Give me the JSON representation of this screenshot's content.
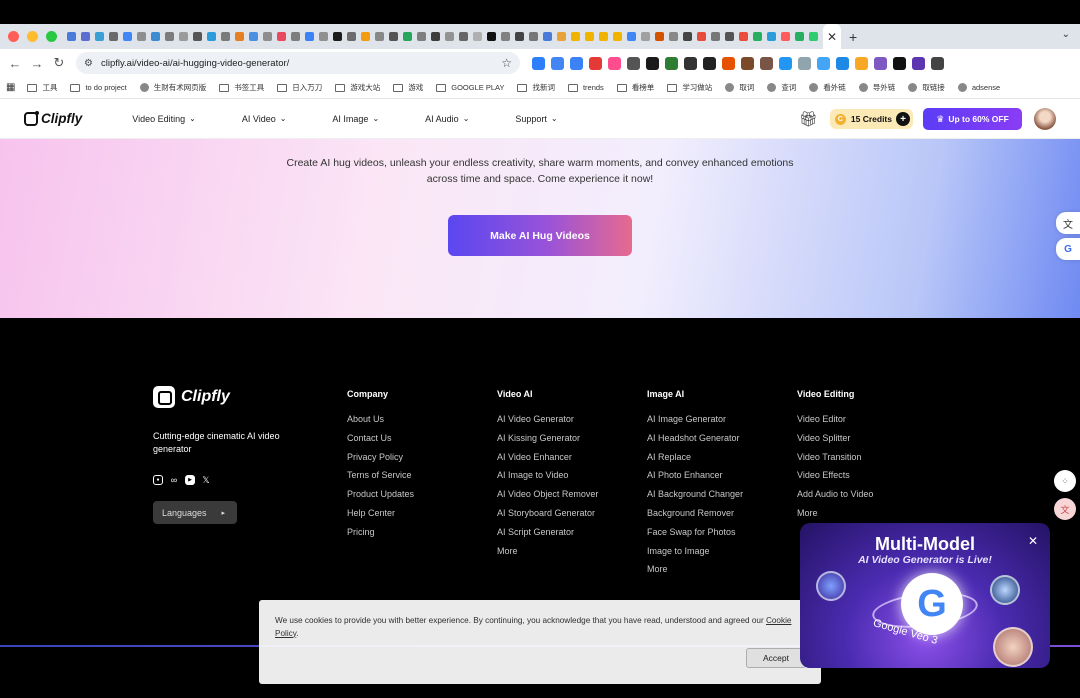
{
  "browser": {
    "url": "clipfly.ai/video-ai/ai-hugging-video-generator/",
    "bookmarks": [
      "工具",
      "to do project",
      "生财有术网页版",
      "书签工具",
      "日入万刀",
      "游戏大站",
      "游戏",
      "GOOGLE PLAY",
      "找新词",
      "trends",
      "看榜单",
      "学习做站",
      "取词",
      "查词",
      "看外链",
      "导外链",
      "取链接",
      "adsense"
    ],
    "bookmark_icons": [
      "folder",
      "folder",
      "globe",
      "folder",
      "folder",
      "folder",
      "folder",
      "folder",
      "folder",
      "folder",
      "folder",
      "folder",
      "globe",
      "globe",
      "globe",
      "globe",
      "globe",
      "globe"
    ]
  },
  "header": {
    "logo": "Clipfly",
    "nav": [
      "Video Editing",
      "AI Video",
      "AI Image",
      "AI Audio",
      "Support"
    ],
    "credits": "15 Credits",
    "promo": "Up to 60% OFF"
  },
  "hero": {
    "text": "Create AI hug videos, unleash your endless creativity, share warm moments, and convey enhanced emotions across time and space. Come experience it now!",
    "button": "Make AI Hug Videos"
  },
  "footer": {
    "logo": "Clipfly",
    "tagline": "Cutting-edge cinematic AI video generator",
    "languages": "Languages",
    "columns": [
      {
        "title": "Company",
        "links": [
          "About Us",
          "Contact Us",
          "Privacy Policy",
          "Terns of Service",
          "Product Updates",
          "Help Center",
          "Pricing"
        ]
      },
      {
        "title": "Video AI",
        "links": [
          "AI Video Generator",
          "AI Kissing Generator",
          "AI Video Enhancer",
          "AI Image to Video",
          "AI Video Object Remover",
          "AI Storyboard Generator",
          "AI Script Generator",
          "More"
        ]
      },
      {
        "title": "Image AI",
        "links": [
          "AI Image Generator",
          "AI Headshot Generator",
          "AI Replace",
          "AI Photo Enhancer",
          "AI Background Changer",
          "Background Remover",
          "Face Swap for Photos",
          "Image to Image",
          "More"
        ]
      },
      {
        "title": "Video Editing",
        "links": [
          "Video Editor",
          "Video Splitter",
          "Video Transition",
          "Video Effects",
          "Add Audio to Video",
          "More"
        ]
      }
    ]
  },
  "cookie": {
    "text": "We use cookies to provide you with better experience. By continuing, you acknowledge that you have read, understood and agreed our",
    "link": "Cookie Policy",
    "accept": "Accept"
  },
  "popup": {
    "title": "Multi-Model",
    "subtitle": "AI Video Generator is Live!",
    "badge": "Google Veo 3"
  },
  "colors": {
    "accent": "#5b3cf5",
    "credits_bg": "#fbe9b6"
  }
}
